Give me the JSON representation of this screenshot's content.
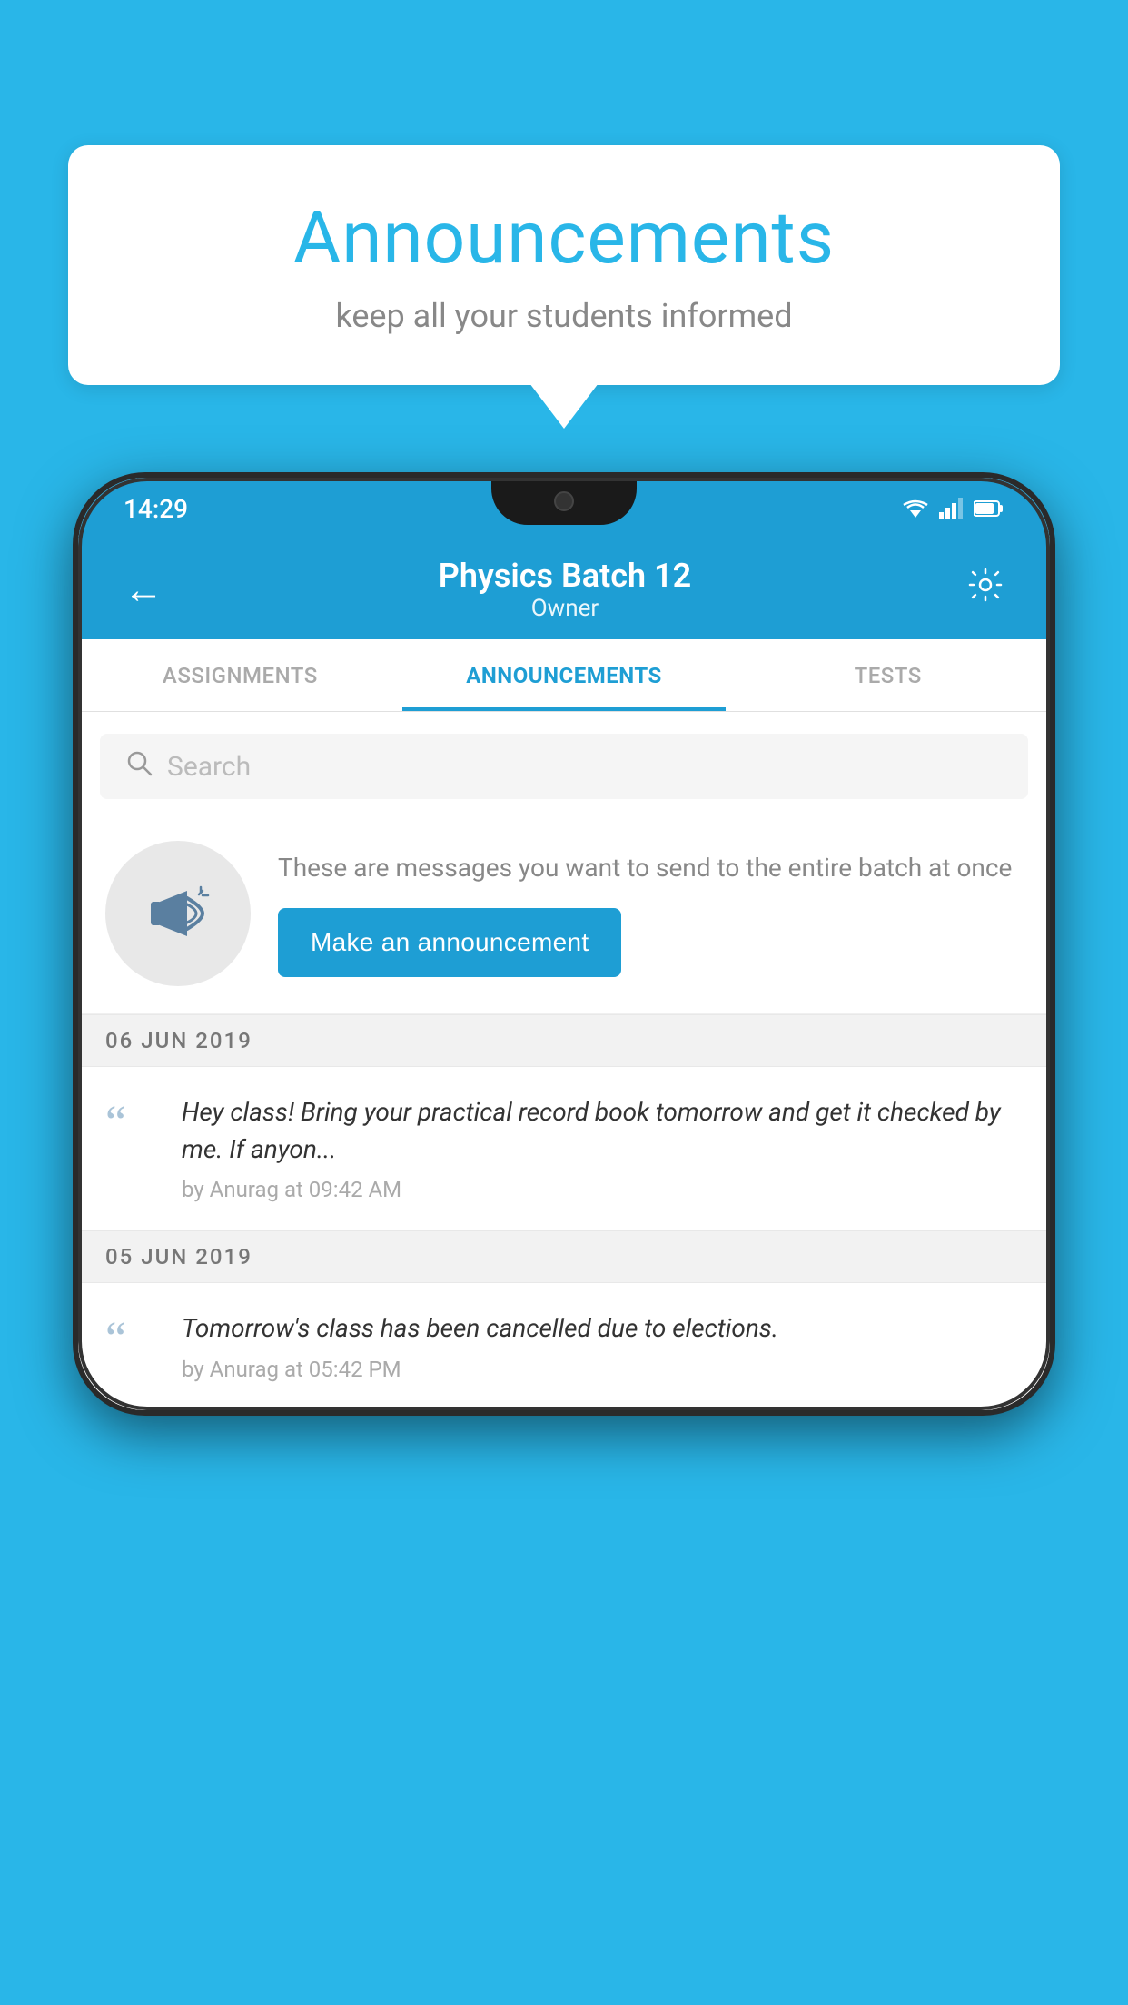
{
  "page": {
    "background_color": "#29b6e8"
  },
  "speech_bubble": {
    "title": "Announcements",
    "subtitle": "keep all your students informed"
  },
  "phone": {
    "status_bar": {
      "time": "14:29"
    },
    "app_bar": {
      "title": "Physics Batch 12",
      "subtitle": "Owner",
      "back_label": "←",
      "gear_label": "⚙"
    },
    "tabs": [
      {
        "label": "ASSIGNMENTS",
        "active": false
      },
      {
        "label": "ANNOUNCEMENTS",
        "active": true
      },
      {
        "label": "TESTS",
        "active": false
      }
    ],
    "search": {
      "placeholder": "Search"
    },
    "promo": {
      "description": "These are messages you want to send to the entire batch at once",
      "button_label": "Make an announcement"
    },
    "announcements": [
      {
        "date": "06  JUN  2019",
        "text": "Hey class! Bring your practical record book tomorrow and get it checked by me. If anyon...",
        "meta": "by Anurag at 09:42 AM"
      },
      {
        "date": "05  JUN  2019",
        "text": "Tomorrow's class has been cancelled due to elections.",
        "meta": "by Anurag at 05:42 PM"
      }
    ]
  }
}
